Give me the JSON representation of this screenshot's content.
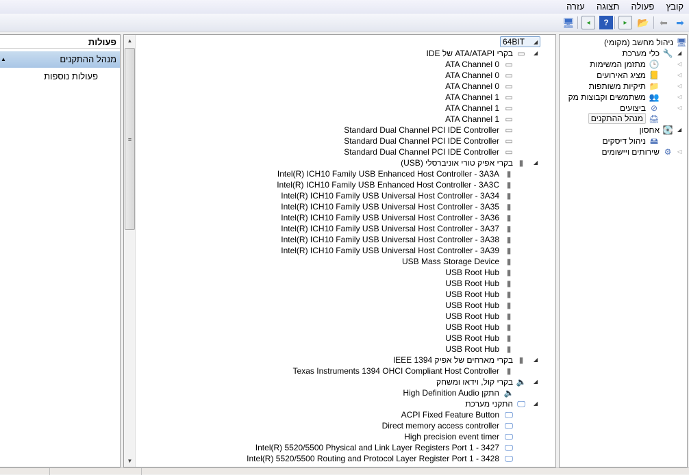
{
  "menu": [
    "קובץ",
    "פעולה",
    "תצוגה",
    "עזרה"
  ],
  "toolbar": {
    "icons": [
      "back-arrow-icon",
      "forward-arrow-icon",
      "up-folder-icon",
      "show-hide-tree-icon",
      "help-icon",
      "show-hide-action-pane-icon",
      "scan-hardware-icon"
    ]
  },
  "nav_tree": [
    {
      "label": "ניהול מחשב (מקומי)",
      "level": 0,
      "icon": "computer-management-icon",
      "glyph": "🖥",
      "exp": ""
    },
    {
      "label": "כלי מערכת",
      "level": 1,
      "icon": "tools-icon",
      "glyph": "🔧",
      "exp": "open"
    },
    {
      "label": "מתזמן המשימות",
      "level": 2,
      "icon": "clock-icon",
      "glyph": "🕒",
      "exp": "closed"
    },
    {
      "label": "מציג האירועים",
      "level": 2,
      "icon": "event-viewer-icon",
      "glyph": "📒",
      "exp": "closed"
    },
    {
      "label": "תיקיות משותפות",
      "level": 2,
      "icon": "shared-folder-icon",
      "glyph": "📁",
      "exp": "closed"
    },
    {
      "label": "משתמשים וקבוצות מק",
      "level": 2,
      "icon": "users-icon",
      "glyph": "👥",
      "exp": "closed"
    },
    {
      "label": "ביצועים",
      "level": 2,
      "icon": "performance-icon",
      "glyph": "⊘",
      "exp": "closed"
    },
    {
      "label": "מנהל ההתקנים",
      "level": 2,
      "icon": "device-manager-icon",
      "glyph": "🖨",
      "exp": "",
      "selected": true
    },
    {
      "label": "אחסון",
      "level": 1,
      "icon": "storage-icon",
      "glyph": "💽",
      "exp": "open"
    },
    {
      "label": "ניהול דיסקים",
      "level": 2,
      "icon": "disk-icon",
      "glyph": "🖴",
      "exp": ""
    },
    {
      "label": "שירותים ויישומים",
      "level": 1,
      "icon": "services-icon",
      "glyph": "⚙",
      "exp": "closed"
    }
  ],
  "devices": [
    {
      "label": "64BIT",
      "level": 0,
      "icon": "computer-icon",
      "glyph": "🖳"
    },
    {
      "label": "בקרי ATA/ATAPI של IDE",
      "level": 1,
      "icon": "ide-controller-icon",
      "glyph": "▭"
    },
    {
      "label": "ATA Channel 0",
      "level": 2,
      "icon": "ide-controller-icon",
      "glyph": "▭"
    },
    {
      "label": "ATA Channel 0",
      "level": 2,
      "icon": "ide-controller-icon",
      "glyph": "▭"
    },
    {
      "label": "ATA Channel 0",
      "level": 2,
      "icon": "ide-controller-icon",
      "glyph": "▭"
    },
    {
      "label": "ATA Channel 1",
      "level": 2,
      "icon": "ide-controller-icon",
      "glyph": "▭"
    },
    {
      "label": "ATA Channel 1",
      "level": 2,
      "icon": "ide-controller-icon",
      "glyph": "▭"
    },
    {
      "label": "ATA Channel 1",
      "level": 2,
      "icon": "ide-controller-icon",
      "glyph": "▭"
    },
    {
      "label": "Standard Dual Channel PCI IDE Controller",
      "level": 2,
      "icon": "ide-controller-icon",
      "glyph": "▭"
    },
    {
      "label": "Standard Dual Channel PCI IDE Controller",
      "level": 2,
      "icon": "ide-controller-icon",
      "glyph": "▭"
    },
    {
      "label": "Standard Dual Channel PCI IDE Controller",
      "level": 2,
      "icon": "ide-controller-icon",
      "glyph": "▭"
    },
    {
      "label": "בקרי אפיק טורי אוניברסלי (USB)",
      "level": 1,
      "icon": "usb-icon",
      "glyph": "▮"
    },
    {
      "label": "Intel(R) ICH10 Family USB Enhanced Host Controller - 3A3A",
      "level": 2,
      "icon": "usb-icon",
      "glyph": "▮"
    },
    {
      "label": "Intel(R) ICH10 Family USB Enhanced Host Controller - 3A3C",
      "level": 2,
      "icon": "usb-icon",
      "glyph": "▮"
    },
    {
      "label": "Intel(R) ICH10 Family USB Universal Host Controller - 3A34",
      "level": 2,
      "icon": "usb-icon",
      "glyph": "▮"
    },
    {
      "label": "Intel(R) ICH10 Family USB Universal Host Controller - 3A35",
      "level": 2,
      "icon": "usb-icon",
      "glyph": "▮"
    },
    {
      "label": "Intel(R) ICH10 Family USB Universal Host Controller - 3A36",
      "level": 2,
      "icon": "usb-icon",
      "glyph": "▮"
    },
    {
      "label": "Intel(R) ICH10 Family USB Universal Host Controller - 3A37",
      "level": 2,
      "icon": "usb-icon",
      "glyph": "▮"
    },
    {
      "label": "Intel(R) ICH10 Family USB Universal Host Controller - 3A38",
      "level": 2,
      "icon": "usb-icon",
      "glyph": "▮"
    },
    {
      "label": "Intel(R) ICH10 Family USB Universal Host Controller - 3A39",
      "level": 2,
      "icon": "usb-icon",
      "glyph": "▮"
    },
    {
      "label": "USB Mass Storage Device",
      "level": 2,
      "icon": "usb-icon",
      "glyph": "▮"
    },
    {
      "label": "USB Root Hub",
      "level": 2,
      "icon": "usb-icon",
      "glyph": "▮"
    },
    {
      "label": "USB Root Hub",
      "level": 2,
      "icon": "usb-icon",
      "glyph": "▮"
    },
    {
      "label": "USB Root Hub",
      "level": 2,
      "icon": "usb-icon",
      "glyph": "▮"
    },
    {
      "label": "USB Root Hub",
      "level": 2,
      "icon": "usb-icon",
      "glyph": "▮"
    },
    {
      "label": "USB Root Hub",
      "level": 2,
      "icon": "usb-icon",
      "glyph": "▮"
    },
    {
      "label": "USB Root Hub",
      "level": 2,
      "icon": "usb-icon",
      "glyph": "▮"
    },
    {
      "label": "USB Root Hub",
      "level": 2,
      "icon": "usb-icon",
      "glyph": "▮"
    },
    {
      "label": "USB Root Hub",
      "level": 2,
      "icon": "usb-icon",
      "glyph": "▮"
    },
    {
      "label": "בקרי מארחים של אפיק IEEE 1394",
      "level": 1,
      "icon": "firewire-icon",
      "glyph": "▮"
    },
    {
      "label": "Texas Instruments 1394 OHCI Compliant Host Controller",
      "level": 2,
      "icon": "firewire-icon",
      "glyph": "▮"
    },
    {
      "label": "בקרי קול, וידאו ומשחק",
      "level": 1,
      "icon": "speaker-icon",
      "glyph": "🔈"
    },
    {
      "label": "התקן High Definition Audio",
      "level": 2,
      "icon": "speaker-icon",
      "glyph": "🔈"
    },
    {
      "label": "התקני מערכת",
      "level": 1,
      "icon": "system-device-icon",
      "glyph": "🖵"
    },
    {
      "label": "ACPI Fixed Feature Button",
      "level": 2,
      "icon": "system-device-icon",
      "glyph": "🖵"
    },
    {
      "label": "Direct memory access controller",
      "level": 2,
      "icon": "system-device-icon",
      "glyph": "🖵"
    },
    {
      "label": "High precision event timer",
      "level": 2,
      "icon": "system-device-icon",
      "glyph": "🖵"
    },
    {
      "label": "Intel(R) 5520/5500 Physical and Link Layer Registers Port 1 - 3427",
      "level": 2,
      "icon": "system-device-icon",
      "glyph": "🖵"
    },
    {
      "label": "Intel(R) 5520/5500 Routing and Protocol Layer Register Port 1 - 3428",
      "level": 2,
      "icon": "system-device-icon",
      "glyph": "🖵"
    }
  ],
  "actions": {
    "title": "פעולות",
    "section": "מנהל ההתקנים",
    "more": "פעולות נוספות"
  }
}
